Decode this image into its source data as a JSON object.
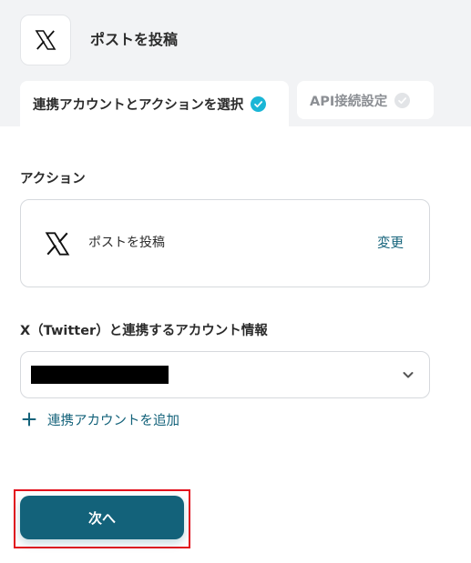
{
  "header": {
    "title": "ポストを投稿",
    "app_icon": "x-logo-icon"
  },
  "tabs": [
    {
      "label": "連携アカウントとアクションを選択",
      "status": "complete",
      "status_icon": "check-circle-icon",
      "active": true
    },
    {
      "label": "API接続設定",
      "status": "incomplete",
      "status_icon": "check-circle-icon",
      "active": false
    }
  ],
  "action_section": {
    "label": "アクション",
    "action_name": "ポストを投稿",
    "change_label": "変更",
    "app_icon": "x-logo-icon"
  },
  "account_section": {
    "label": "X（Twitter）と連携するアカウント情報",
    "selected_value_redacted": true,
    "add_account_label": "連携アカウントを追加"
  },
  "footer": {
    "next_label": "次へ"
  },
  "colors": {
    "primary": "#13627a",
    "check_done": "#1ab6d6",
    "highlight": "#e3101d",
    "band": "#f2f3f5"
  }
}
